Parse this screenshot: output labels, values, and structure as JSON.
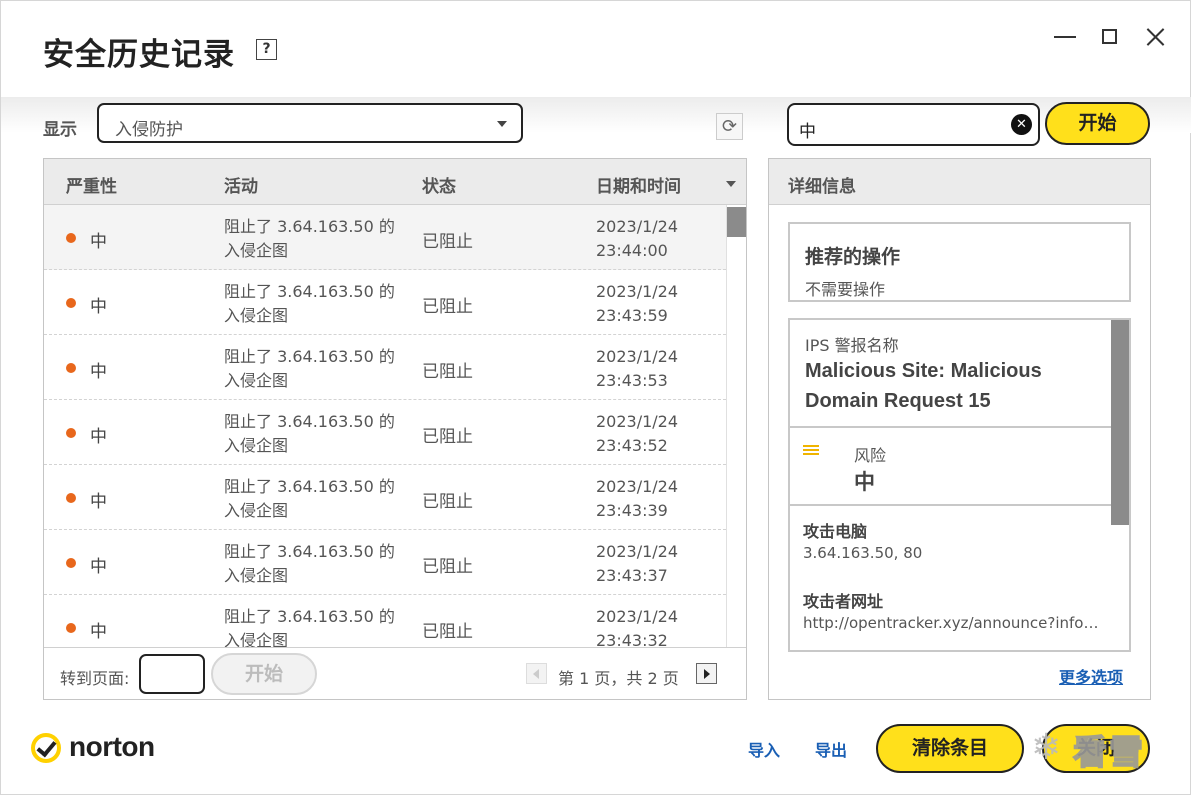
{
  "window": {
    "title": "安全历史记录",
    "help_label": "?"
  },
  "filter": {
    "label": "显示",
    "selected": "入侵防护"
  },
  "search": {
    "value": "中",
    "clear_label": "✕",
    "start_label": "开始"
  },
  "table": {
    "columns": [
      "严重性",
      "活动",
      "状态",
      "日期和时间"
    ],
    "rows": [
      {
        "severity": "中",
        "activity": "阻止了 3.64.163.50 的入侵企图",
        "status": "已阻止",
        "date": "2023/1/24",
        "time": "23:44:00"
      },
      {
        "severity": "中",
        "activity": "阻止了 3.64.163.50 的入侵企图",
        "status": "已阻止",
        "date": "2023/1/24",
        "time": "23:43:59"
      },
      {
        "severity": "中",
        "activity": "阻止了 3.64.163.50 的入侵企图",
        "status": "已阻止",
        "date": "2023/1/24",
        "time": "23:43:53"
      },
      {
        "severity": "中",
        "activity": "阻止了 3.64.163.50 的入侵企图",
        "status": "已阻止",
        "date": "2023/1/24",
        "time": "23:43:52"
      },
      {
        "severity": "中",
        "activity": "阻止了 3.64.163.50 的入侵企图",
        "status": "已阻止",
        "date": "2023/1/24",
        "time": "23:43:39"
      },
      {
        "severity": "中",
        "activity": "阻止了 3.64.163.50 的入侵企图",
        "status": "已阻止",
        "date": "2023/1/24",
        "time": "23:43:37"
      },
      {
        "severity": "中",
        "activity": "阻止了 3.64.163.50 的入侵企图",
        "status": "已阻止",
        "date": "2023/1/24",
        "time": "23:43:32"
      }
    ]
  },
  "pagination": {
    "goto_label": "转到页面:",
    "goto_button": "开始",
    "page_text": "第 1 页，共 2 页"
  },
  "details": {
    "title": "详细信息",
    "recommended_title": "推荐的操作",
    "recommended_value": "不需要操作",
    "ips_label": "IPS 警报名称",
    "ips_value": "Malicious Site: Malicious Domain Request 15",
    "risk_label": "风险",
    "risk_value": "中",
    "attacker_pc_label": "攻击电脑",
    "attacker_pc_value": "3.64.163.50, 80",
    "attacker_url_label": "攻击者网址",
    "attacker_url_value": "http://opentracker.xyz/announce?info_hash",
    "more_options": "更多选项"
  },
  "footer": {
    "logo_text": "norton",
    "import_label": "导入",
    "export_label": "导出",
    "clear_label": "清除条目",
    "close_label": "关闭"
  },
  "watermark": {
    "text": "看雪"
  },
  "colors": {
    "accent_yellow": "#ffe01b",
    "severity_medium": "#e8671c",
    "link_blue": "#1a5fb4"
  }
}
